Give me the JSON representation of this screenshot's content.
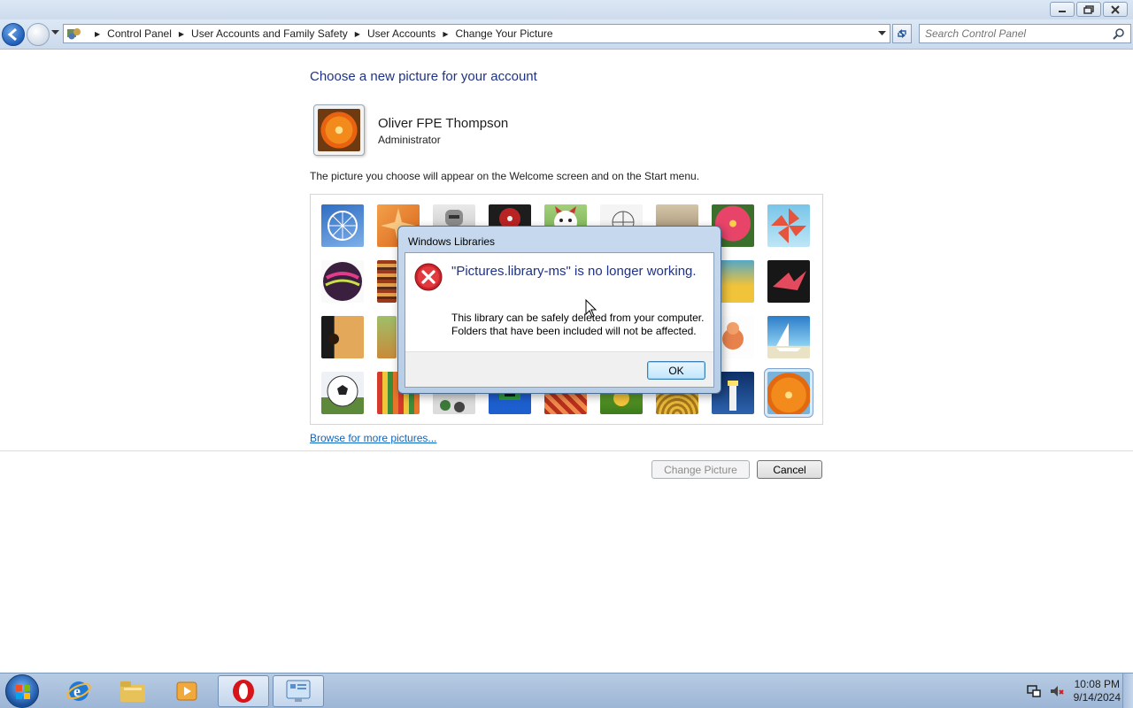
{
  "window": {
    "minimize_icon": "minimize-icon",
    "restore_icon": "restore-icon",
    "close_icon": "close-icon"
  },
  "address": {
    "breadcrumbs": [
      "Control Panel",
      "User Accounts and Family Safety",
      "User Accounts",
      "Change Your Picture"
    ],
    "search_placeholder": "Search Control Panel"
  },
  "main": {
    "title": "Choose a new picture for your account",
    "user_name": "Oliver FPE Thompson",
    "user_role": "Administrator",
    "description": "The picture you choose will appear on the Welcome screen and on the Start menu.",
    "browse_link": "Browse for more pictures...",
    "selected_picture": "orange-flower",
    "pictures": [
      "ferris-wheel",
      "orange-star",
      "robot",
      "record-player",
      "lucky-cat",
      "globe-lines",
      "kitten",
      "pink-flower",
      "pinwheel",
      "bowling-ball",
      "striped-fabric",
      "hidden",
      "hidden",
      "hidden",
      "hidden",
      "hidden",
      "yellow-steps",
      "origami-crane",
      "guitar",
      "puppy",
      "hidden",
      "hidden",
      "hidden",
      "hidden",
      "hidden",
      "snowman-toy",
      "sailboat",
      "soccer-ball",
      "colored-pencils",
      "marbles",
      "green-frame",
      "red-pattern",
      "yellow-bug",
      "golden-spiral",
      "lighthouse",
      "orange-flower"
    ]
  },
  "buttons": {
    "change_picture": "Change Picture",
    "cancel": "Cancel",
    "ok": "OK"
  },
  "dialog": {
    "title": "Windows Libraries",
    "message": "\"Pictures.library-ms\" is no longer working.",
    "detail": "This library can be safely deleted from your computer. Folders that have been included will not be affected.",
    "icon": "error-icon"
  },
  "taskbar": {
    "items": [
      "start-button",
      "internet-explorer",
      "file-explorer",
      "media-player",
      "opera",
      "control-panel"
    ],
    "time": "10:08 PM",
    "date": "9/14/2024"
  },
  "colors": {
    "heading_blue": "#1e3287",
    "link_blue": "#0a66c2",
    "error_red": "#c8242a"
  }
}
